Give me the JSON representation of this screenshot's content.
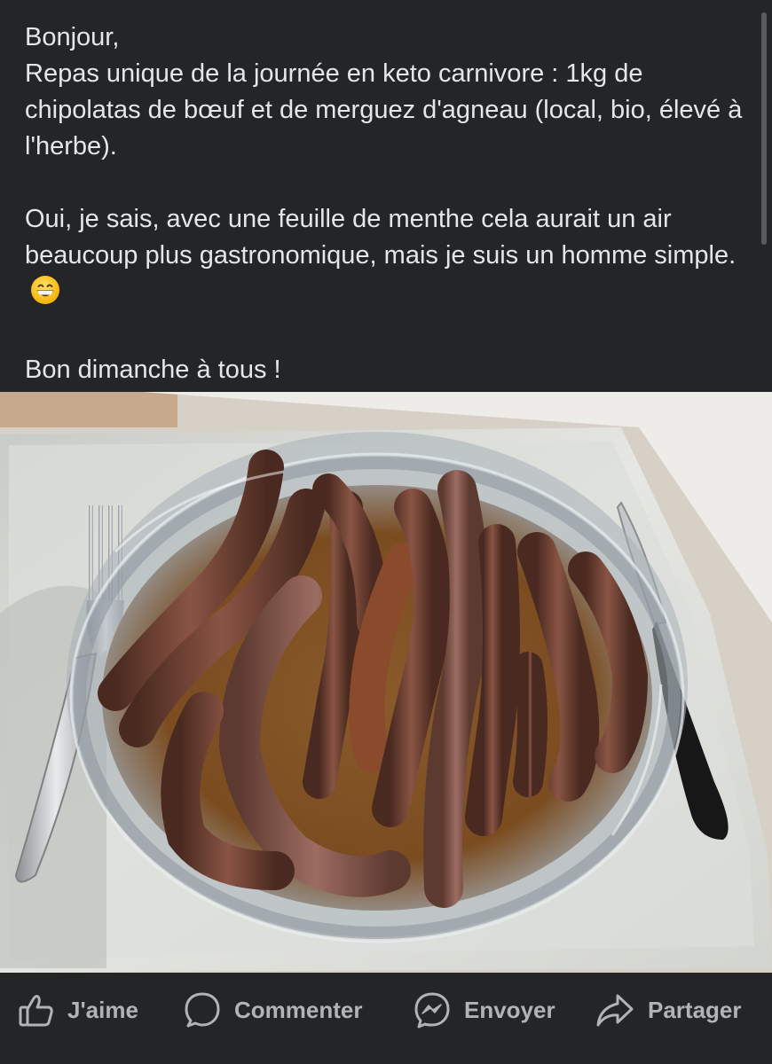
{
  "post": {
    "greeting": "Bonjour,",
    "paragraph1": "Repas unique de la journée en keto carnivore : 1kg de chipolatas de bœuf et de merguez d'agneau (local, bio, élevé à l'herbe).",
    "paragraph2": "Oui, je sais, avec une feuille de menthe cela aurait un air beaucoup plus gastronomique, mais je suis un homme simple.",
    "emoji_icon": "grinning-face-emoji",
    "paragraph3": "Bon dimanche à tous !"
  },
  "photo": {
    "subject": "sausages-in-glass-dish-photo"
  },
  "actions": {
    "like": {
      "label": "J'aime",
      "icon": "thumbs-up-icon"
    },
    "comment": {
      "label": "Commenter",
      "icon": "comment-bubble-icon"
    },
    "send": {
      "label": "Envoyer",
      "icon": "messenger-icon"
    },
    "share": {
      "label": "Partager",
      "icon": "share-arrow-icon"
    }
  },
  "colors": {
    "background": "#242526",
    "text": "#e4e6eb",
    "action_text": "#b0b3b8"
  }
}
